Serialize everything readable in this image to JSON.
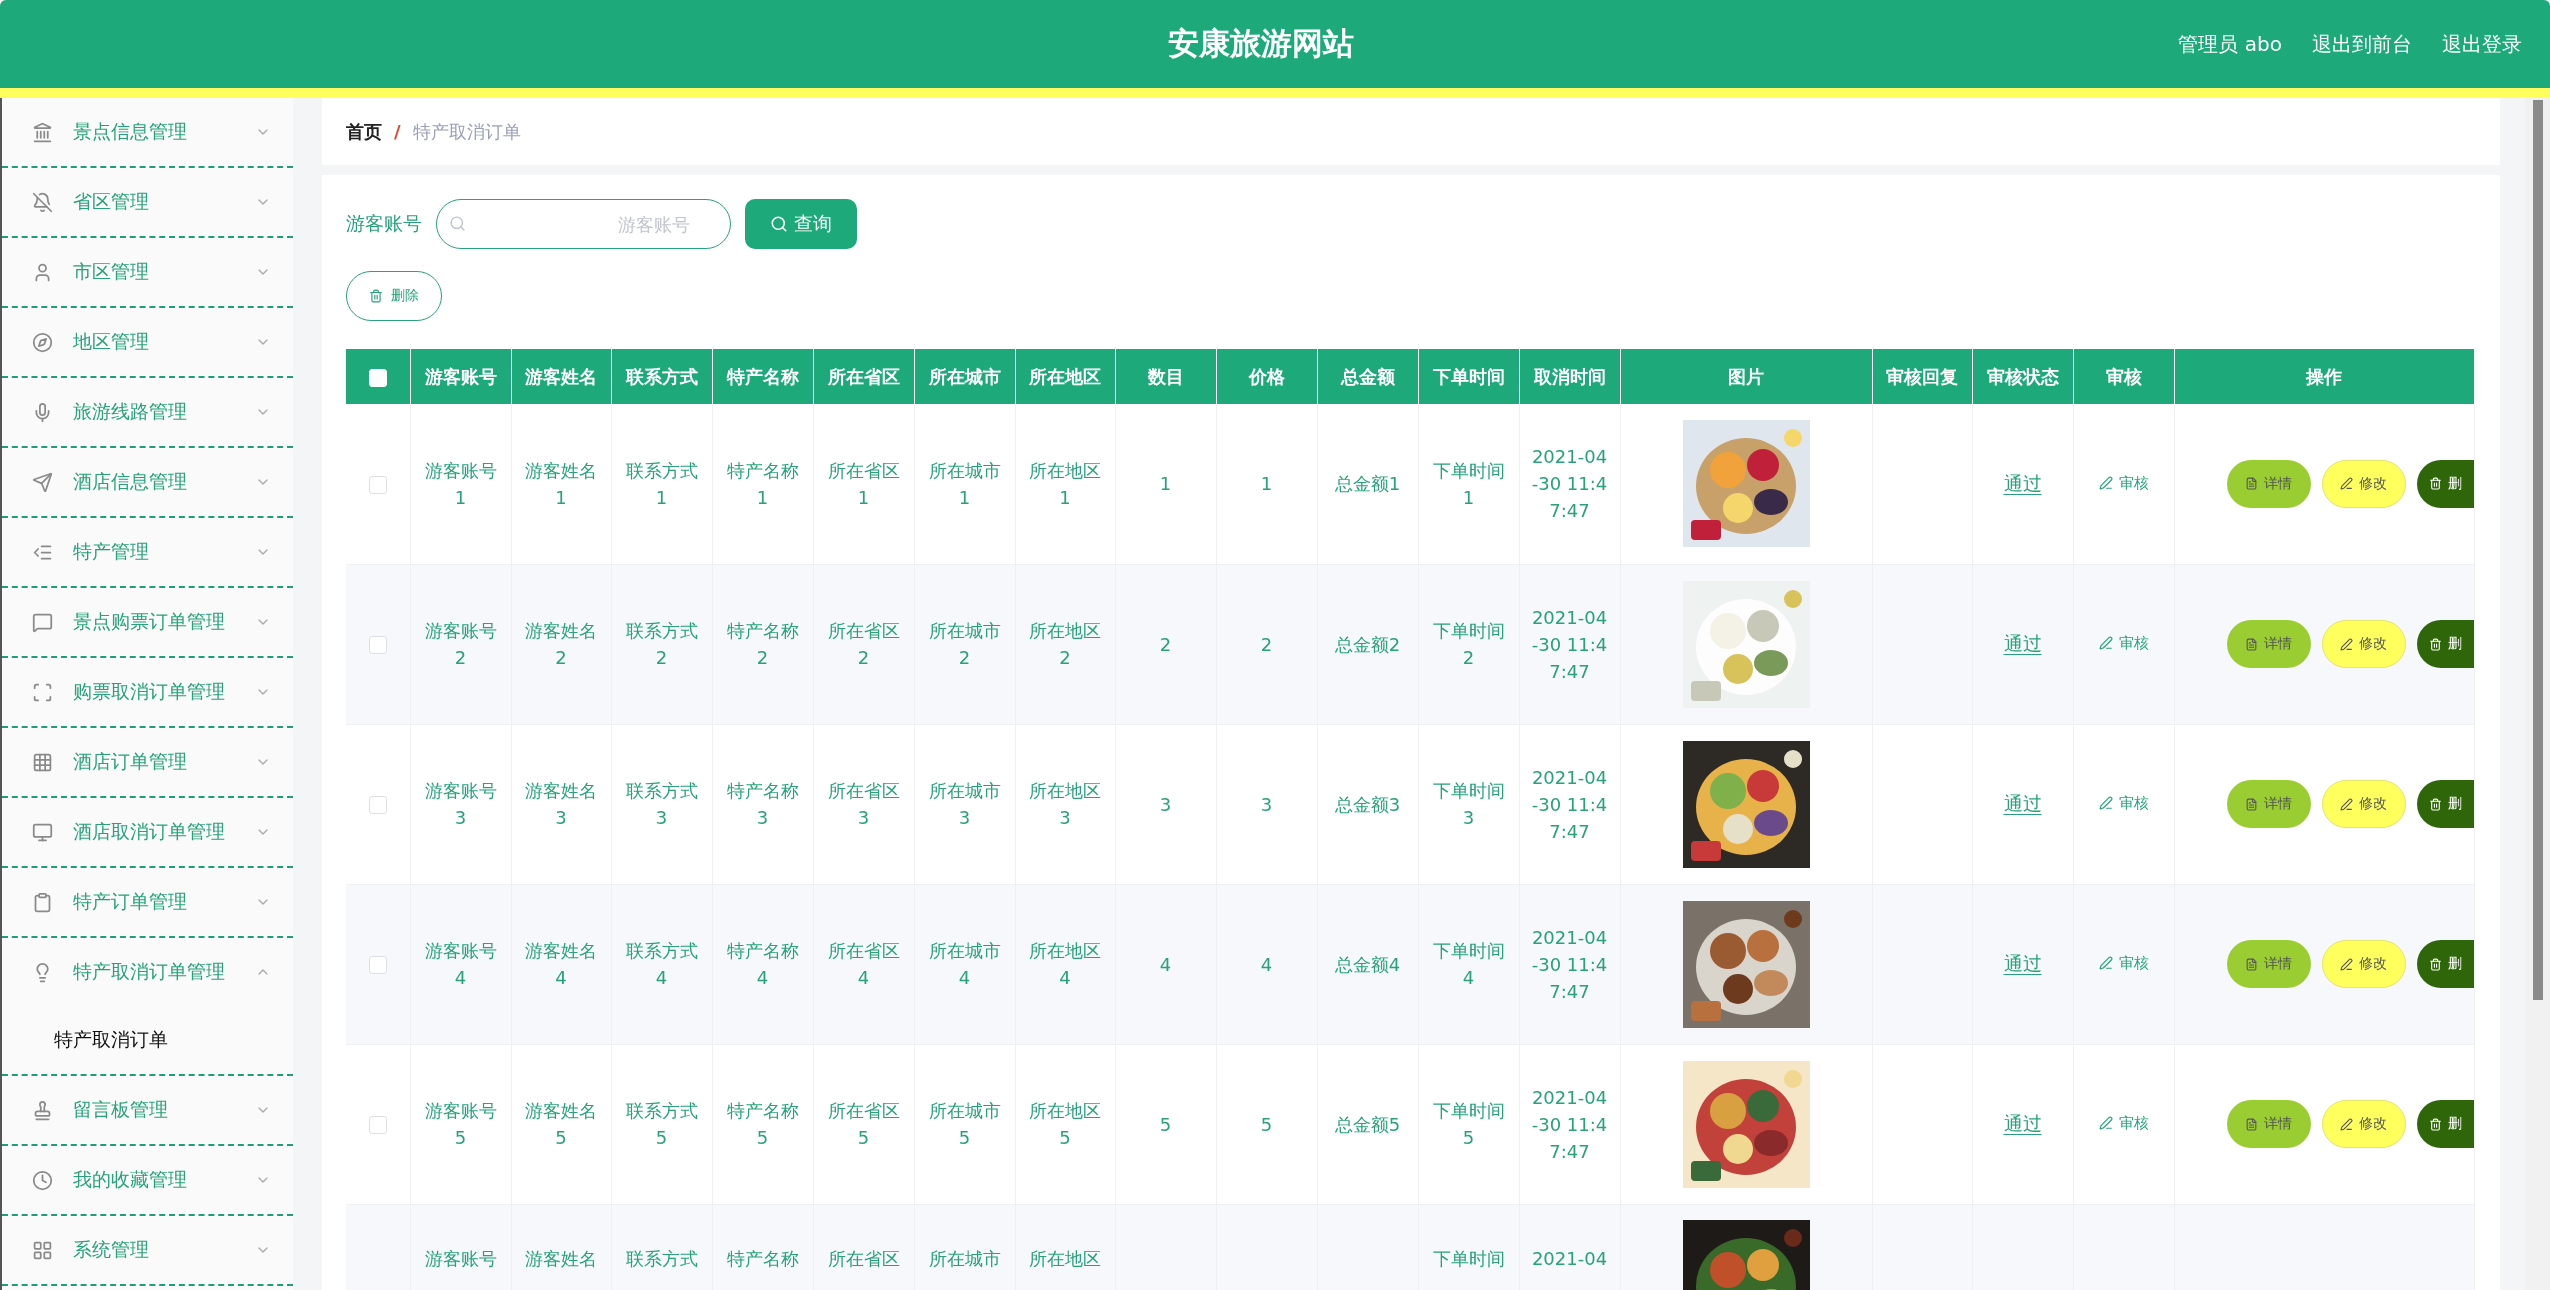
{
  "header": {
    "title": "安康旅游网站",
    "links": [
      "管理员 abo",
      "退出到前台",
      "退出登录"
    ]
  },
  "menu": [
    {
      "label": "景点信息管理",
      "expanded": false
    },
    {
      "label": "省区管理",
      "expanded": false
    },
    {
      "label": "市区管理",
      "expanded": false
    },
    {
      "label": "地区管理",
      "expanded": false
    },
    {
      "label": "旅游线路管理",
      "expanded": false
    },
    {
      "label": "酒店信息管理",
      "expanded": false
    },
    {
      "label": "特产管理",
      "expanded": false
    },
    {
      "label": "景点购票订单管理",
      "expanded": false
    },
    {
      "label": "购票取消订单管理",
      "expanded": false
    },
    {
      "label": "酒店订单管理",
      "expanded": false
    },
    {
      "label": "酒店取消订单管理",
      "expanded": false
    },
    {
      "label": "特产订单管理",
      "expanded": false
    },
    {
      "label": "特产取消订单管理",
      "expanded": true,
      "children": [
        {
          "label": "特产取消订单",
          "selected": true
        }
      ]
    },
    {
      "label": "留言板管理",
      "expanded": false
    },
    {
      "label": "我的收藏管理",
      "expanded": false
    },
    {
      "label": "系统管理",
      "expanded": false
    }
  ],
  "breadcrumb": {
    "home": "首页",
    "separator": "/",
    "current": "特产取消订单"
  },
  "search": {
    "label": "游客账号",
    "placeholder": "游客账号",
    "button": "查询"
  },
  "delete_button": "删除",
  "table": {
    "all_checked": false,
    "columns": [
      "游客账号",
      "游客姓名",
      "联系方式",
      "特产名称",
      "所在省区",
      "所在城市",
      "所在地区",
      "数目",
      "价格",
      "总金额",
      "下单时间",
      "取消时间",
      "图片",
      "审核回复",
      "审核状态",
      "审核",
      "操作"
    ],
    "rows": [
      {
        "checked": false,
        "cells": [
          "游客账号1",
          "游客姓名1",
          "联系方式1",
          "特产名称1",
          "所在省区1",
          "所在城市1",
          "所在地区1",
          "1",
          "1",
          "总金额1",
          "下单时间1",
          "2021-04-30 11:47:47"
        ],
        "status": "通过",
        "review": "审核",
        "actions": [
          "详情",
          "修改",
          "删"
        ]
      },
      {
        "checked": false,
        "cells": [
          "游客账号2",
          "游客姓名2",
          "联系方式2",
          "特产名称2",
          "所在省区2",
          "所在城市2",
          "所在地区2",
          "2",
          "2",
          "总金额2",
          "下单时间2",
          "2021-04-30 11:47:47"
        ],
        "status": "通过",
        "review": "审核",
        "actions": [
          "详情",
          "修改",
          "删"
        ]
      },
      {
        "checked": false,
        "cells": [
          "游客账号3",
          "游客姓名3",
          "联系方式3",
          "特产名称3",
          "所在省区3",
          "所在城市3",
          "所在地区3",
          "3",
          "3",
          "总金额3",
          "下单时间3",
          "2021-04-30 11:47:47"
        ],
        "status": "通过",
        "review": "审核",
        "actions": [
          "详情",
          "修改",
          "删"
        ]
      },
      {
        "checked": false,
        "cells": [
          "游客账号4",
          "游客姓名4",
          "联系方式4",
          "特产名称4",
          "所在省区4",
          "所在城市4",
          "所在地区4",
          "4",
          "4",
          "总金额4",
          "下单时间4",
          "2021-04-30 11:47:47"
        ],
        "status": "通过",
        "review": "审核",
        "actions": [
          "详情",
          "修改",
          "删"
        ]
      },
      {
        "checked": false,
        "cells": [
          "游客账号5",
          "游客姓名5",
          "联系方式5",
          "特产名称5",
          "所在省区5",
          "所在城市5",
          "所在地区5",
          "5",
          "5",
          "总金额5",
          "下单时间5",
          "2021-04-30 11:47:47"
        ],
        "status": "通过",
        "review": "审核",
        "actions": [
          "详情",
          "修改",
          "删"
        ]
      },
      {
        "cut": true,
        "cells": [
          "游客账号",
          "游客姓名",
          "联系方式",
          "特产名称",
          "所在省区",
          "所在城市",
          "所在地区",
          null,
          null,
          null,
          "下单时间",
          "2021-04"
        ]
      }
    ]
  }
}
